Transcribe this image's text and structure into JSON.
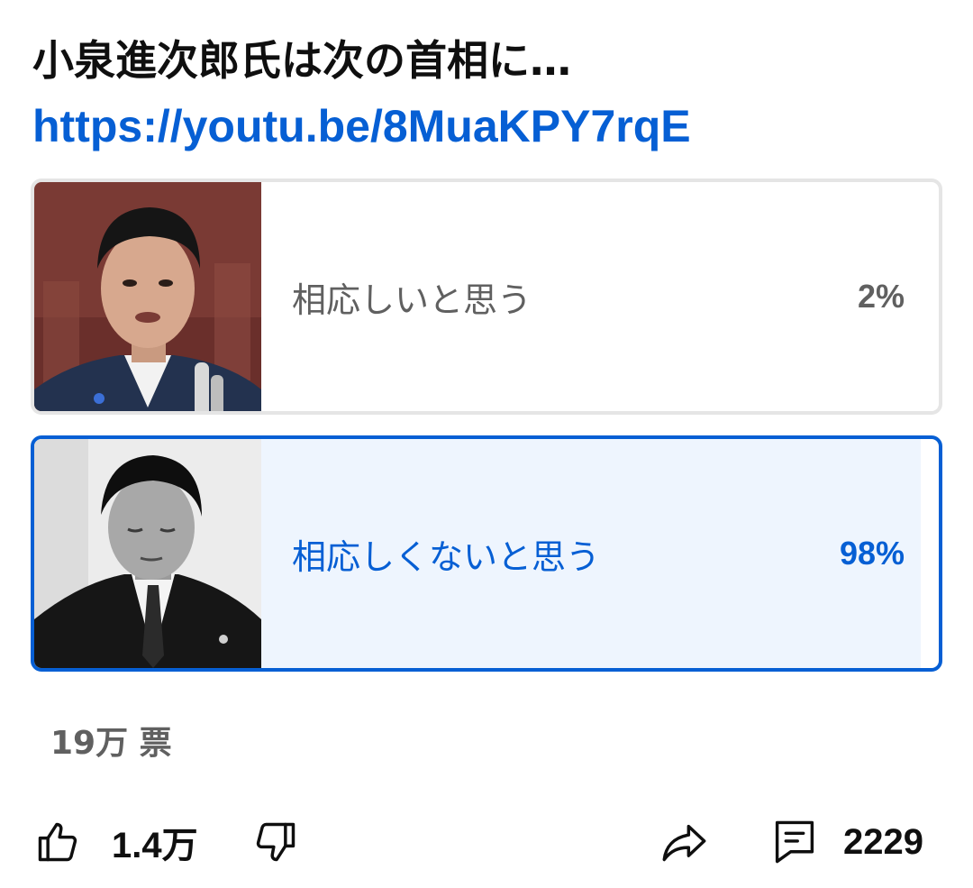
{
  "post": {
    "title": "小泉進次郎氏は次の首相に…",
    "link": "https://youtu.be/8MuaKPY7rqE"
  },
  "poll": {
    "options": [
      {
        "label": "相応しいと思う",
        "percent_text": "2%",
        "percent": 2,
        "selected": false,
        "image": "koizumi-speaking-photo"
      },
      {
        "label": "相応しくないと思う",
        "percent_text": "98%",
        "percent": 98,
        "selected": true,
        "image": "koizumi-bowing-bw-photo"
      }
    ],
    "vote_count": "19万 票"
  },
  "actions": {
    "like_count": "1.4万",
    "comment_count": "2229",
    "icons": [
      "like-icon",
      "dislike-icon",
      "share-icon",
      "comment-icon"
    ]
  },
  "colors": {
    "accent": "#065fd4",
    "selected_fill": "#eef5fe",
    "unselected_fill": "#f2f2f2",
    "muted_text": "#606060"
  }
}
